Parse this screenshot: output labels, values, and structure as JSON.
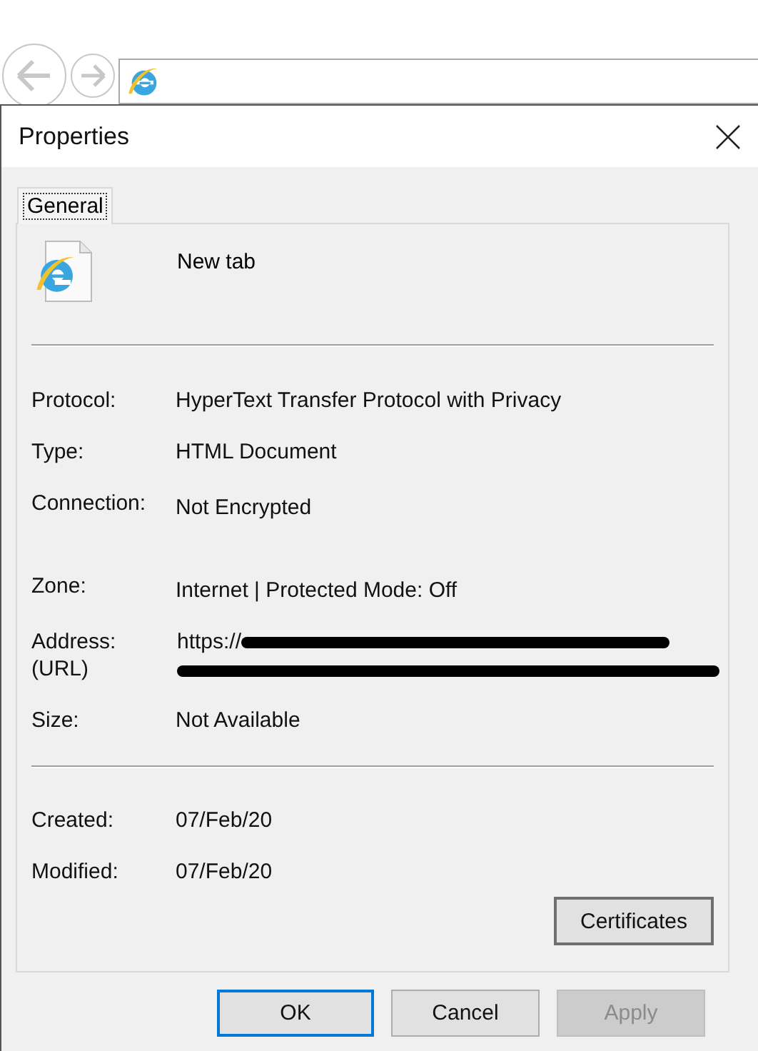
{
  "window": {
    "title": "Properties"
  },
  "tabs": [
    {
      "label": "General",
      "selected": true
    }
  ],
  "header": {
    "name": "New tab"
  },
  "sections": [
    [
      {
        "label": "Protocol:",
        "value": "HyperText Transfer Protocol with Privacy"
      },
      {
        "label": "Type:",
        "value": "HTML Document"
      },
      {
        "label": "Connection:",
        "value": "Not Encrypted"
      },
      {
        "label": "Zone:",
        "value": "Internet | Protected Mode: Off"
      },
      {
        "label": "Address:\n(URL)",
        "value": "https://",
        "redacted": true
      },
      {
        "label": "Size:",
        "value": "Not Available"
      }
    ],
    [
      {
        "label": "Created:",
        "value": "07/Feb/20"
      },
      {
        "label": "Modified:",
        "value": "07/Feb/20"
      }
    ]
  ],
  "panel_button": {
    "label": "Certificates"
  },
  "buttons": [
    {
      "label": "OK",
      "default": true,
      "disabled": false
    },
    {
      "label": "Cancel",
      "default": false,
      "disabled": false
    },
    {
      "label": "Apply",
      "default": false,
      "disabled": true
    }
  ]
}
